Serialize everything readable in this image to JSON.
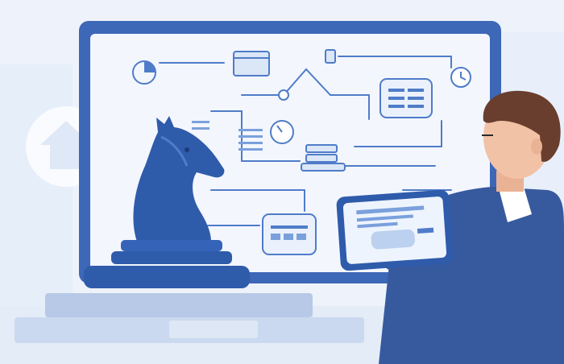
{
  "scene": {
    "subject": "illustration",
    "palette": {
      "background": "#eef3fb",
      "monitor_frame": "#3d67b7",
      "screen": "#f7f9fd",
      "line_art": "#4f7cc9",
      "knight": "#2f5bab",
      "pedestal": "#b7c9e6",
      "suit": "#375a9e",
      "hair": "#6a3e2e",
      "skin": "#f2c2a6"
    },
    "icons": [
      "pie-chart-icon",
      "window-icon",
      "clock-icon",
      "document-card-icon",
      "list-icon",
      "gauge-icon",
      "stacked-server-icon",
      "calendar-card-icon",
      "tablet-icon"
    ]
  }
}
